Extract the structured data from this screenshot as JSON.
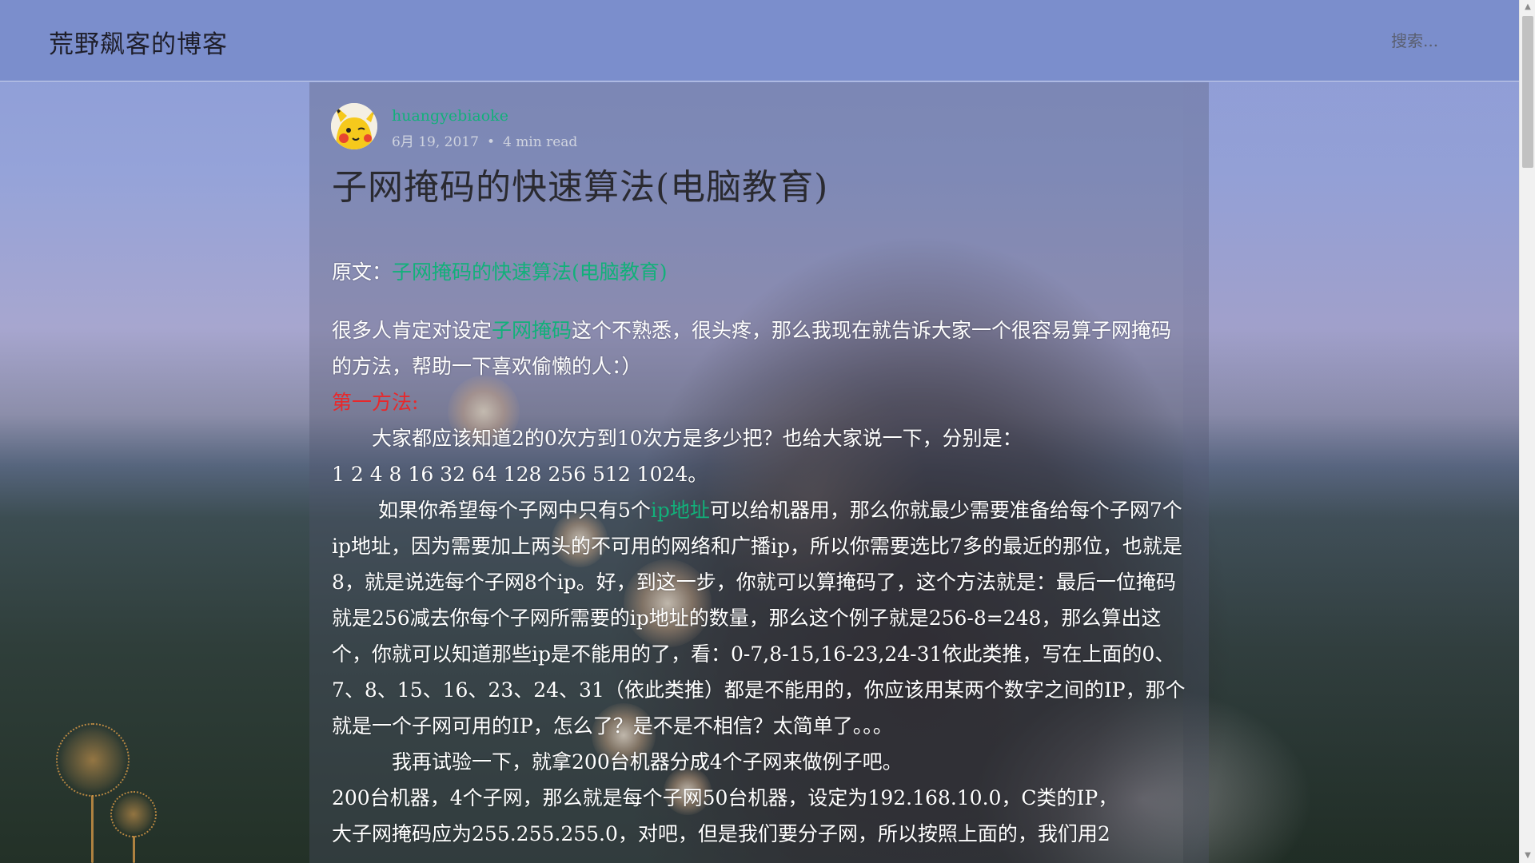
{
  "header": {
    "site_title": "荒野飙客的博客",
    "search_placeholder": "搜索..."
  },
  "post": {
    "author": "huangyebiaoke",
    "date": "6月 19, 2017",
    "separator": "•",
    "read_time": "4 min read",
    "title": "子网掩码的快速算法(电脑教育)"
  },
  "article": {
    "source_prefix": "原文：",
    "source_link": "子网掩码的快速算法(电脑教育)",
    "p1_a": "很多人肯定对设定",
    "p1_link": "子网掩码",
    "p1_b": "这个不熟悉，很头疼，那么我现在就告诉大家一个很容易算子网掩码的方法，帮助一下喜欢偷懒的人：）",
    "method_heading": "第一方法:",
    "p2": "　　大家都应该知道2的0次方到10次方是多少把？也给大家说一下，分别是：",
    "p3": "1 2 4 8 16 32 64 128 256 512 1024。",
    "p4_a": "　　 如果你希望每个子网中只有5个",
    "p4_link": "ip地址",
    "p4_b": "可以给机器用，那么你就最少需要准备给每个子网7个ip地址，因为需要加上两头的不可用的网络和广播ip，所以你需要选比7多的最近的那位，也就是8，就是说选每个子网8个ip。好，到这一步，你就可以算掩码了，这个方法就是：最后一位掩码就是256减去你每个子网所需要的ip地址的数量，那么这个例子就是256-8=248，那么算出这个，你就可以知道那些ip是不能用的了，看：0-7,8-15,16-23,24-31依此类推，写在上面的0、7、8、15、16、23、24、31（依此类推）都是不能用的，你应该用某两个数字之间的IP，那个就是一个子网可用的IP，怎么了？是不是不相信？太简单了。。。",
    "p5": "　　　我再试验一下，就拿200台机器分成4个子网来做例子吧。",
    "p6": "200台机器，4个子网，那么就是每个子网50台机器，设定为192.168.10.0，C类的IP，",
    "p7": "大子网掩码应为255.255.255.0，对吧，但是我们要分子网，所以按照上面的，我们用2"
  },
  "colors": {
    "header_bg": "#7a8ecb",
    "link": "#12b07a",
    "heading_red": "#e8282b"
  },
  "icons": {
    "scroll_up": "▲",
    "scroll_down": "▼"
  }
}
